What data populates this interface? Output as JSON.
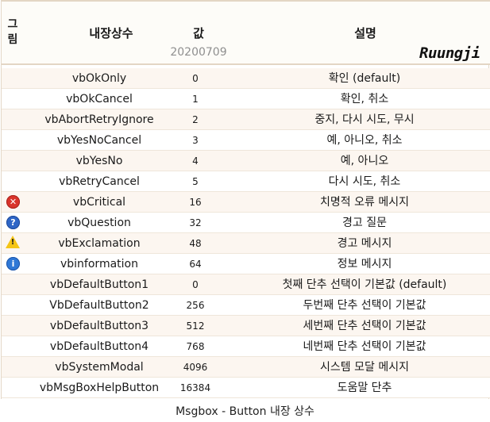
{
  "header": {
    "icon_col": "그\n림",
    "const_col": "내장상수",
    "value_col": "값",
    "value_sub": "20200709",
    "desc_col": "설명",
    "signature": "Ruungji"
  },
  "rows": [
    {
      "icon": "",
      "const": "vbOkOnly",
      "value": "0",
      "desc": "확인 (default)"
    },
    {
      "icon": "",
      "const": "vbOkCancel",
      "value": "1",
      "desc": "확인, 취소"
    },
    {
      "icon": "",
      "const": "vbAbortRetryIgnore",
      "value": "2",
      "desc": "중지, 다시 시도, 무시"
    },
    {
      "icon": "",
      "const": "vbYesNoCancel",
      "value": "3",
      "desc": "예, 아니오, 취소"
    },
    {
      "icon": "",
      "const": "vbYesNo",
      "value": "4",
      "desc": "예, 아니오"
    },
    {
      "icon": "",
      "const": "vbRetryCancel",
      "value": "5",
      "desc": "다시 시도, 취소"
    },
    {
      "icon": "critical-icon",
      "const": "vbCritical",
      "value": "16",
      "desc": "치명적 오류 메시지"
    },
    {
      "icon": "question-icon",
      "const": "vbQuestion",
      "value": "32",
      "desc": "경고 질문"
    },
    {
      "icon": "exclamation-icon",
      "const": "vbExclamation",
      "value": "48",
      "desc": "경고 메시지"
    },
    {
      "icon": "information-icon",
      "const": "vbinformation",
      "value": "64",
      "desc": "정보 메시지"
    },
    {
      "icon": "",
      "const": "vbDefaultButton1",
      "value": "0",
      "desc": "첫째 단추 선택이 기본값 (default)"
    },
    {
      "icon": "",
      "const": "VbDefaultButton2",
      "value": "256",
      "desc": "두번째 단추 선택이 기본값"
    },
    {
      "icon": "",
      "const": "vbDefaultButton3",
      "value": "512",
      "desc": "세번째 단추 선택이 기본값"
    },
    {
      "icon": "",
      "const": "vbDefaultButton4",
      "value": "768",
      "desc": "네번째 단추 선택이 기본값"
    },
    {
      "icon": "",
      "const": "vbSystemModal",
      "value": "4096",
      "desc": "시스템 모달 메시지"
    },
    {
      "icon": "",
      "const": "vbMsgBoxHelpButton",
      "value": "16384",
      "desc": "도움말 단추"
    }
  ],
  "caption": "Msgbox - Button 내장 상수",
  "colors": {
    "critical": "#d9342b",
    "question": "#2f66c6",
    "exclamation": "#f5c516",
    "information": "#2f78d6"
  }
}
